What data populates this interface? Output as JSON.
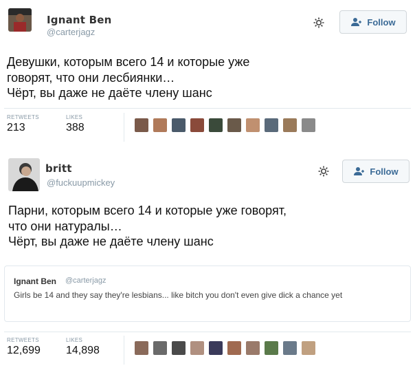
{
  "tweets": [
    {
      "author_name": "Ignant Ben",
      "author_handle": "@carterjagz",
      "follow_label": "Follow",
      "text": "Девушки, которым всего 14 и которые уже\nговорят, что они лесбиянки…\nЧёрт, вы даже не даёте члену шанс",
      "stats": {
        "retweets_label": "RETWEETS",
        "retweets_value": "213",
        "likes_label": "LIKES",
        "likes_value": "388"
      },
      "liker_colors": [
        "#7a5a4a",
        "#b07a5a",
        "#4a5a6a",
        "#8a4a3a",
        "#3a4a3a",
        "#6a5a4a",
        "#c09070",
        "#5a6a7a",
        "#9a7a5a",
        "#8a8a8a"
      ]
    },
    {
      "author_name": "britt",
      "author_handle": "@fuckuupmickey",
      "follow_label": "Follow",
      "text": "Парни, которым всего 14 и которые уже говорят,\nчто они натуралы…\nЧёрт, вы даже не даёте члену шанс",
      "quoted": {
        "name": "Ignant Ben",
        "handle": "@carterjagz",
        "text": "Girls be 14 and they say they're lesbians... like bitch you don't even give dick a chance yet"
      },
      "stats": {
        "retweets_label": "RETWEETS",
        "retweets_value": "12,699",
        "likes_label": "LIKES",
        "likes_value": "14,898"
      },
      "liker_colors": [
        "#8a6a5a",
        "#6a6a6a",
        "#4a4a4a",
        "#b09080",
        "#3a3a5a",
        "#a06a50",
        "#9a7a6a",
        "#5a7a4a",
        "#6a7a8a",
        "#c0a080"
      ]
    }
  ],
  "colors": {
    "follow_text": "#3a6a96",
    "handle": "#8899a6",
    "divider": "#e1e8ed"
  }
}
